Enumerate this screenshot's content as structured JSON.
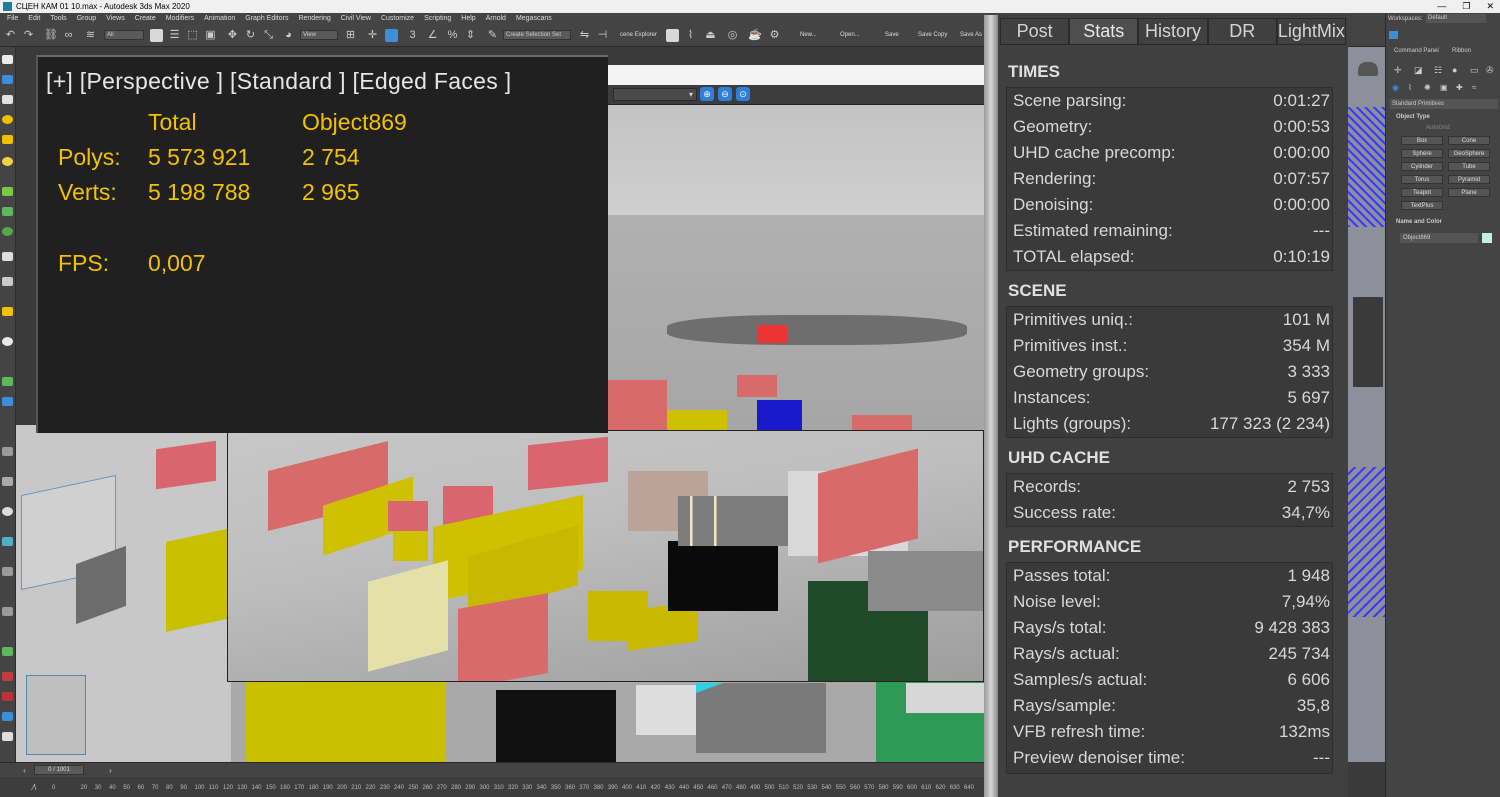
{
  "window": {
    "title": "СЦЕН КАМ 01 10.max - Autodesk 3ds Max 2020",
    "controls": [
      "—",
      "❐",
      "✕"
    ]
  },
  "menu": [
    "File",
    "Edit",
    "Tools",
    "Group",
    "Views",
    "Create",
    "Modifiers",
    "Animation",
    "Graph Editors",
    "Rendering",
    "Civil View",
    "Customize",
    "Scripting",
    "Help",
    "Arnold",
    "Megascans"
  ],
  "toolbar": {
    "filter_dd": "All",
    "view_dd": "View",
    "selection_set_dd": "Create Selection Set",
    "scene_explorer_label": "cene Explorer",
    "new_label": "New...",
    "open_label": "Open...",
    "save_label": "Save",
    "save_copy_label": "Save Copy",
    "save_as_label": "Save As"
  },
  "overlay": {
    "header": "[+] [Perspective ] [Standard ] [Edged Faces ]",
    "col_total": "Total",
    "col_object": "Object869",
    "polys_label": "Polys:",
    "polys_total": "5 573 921",
    "polys_object": "2 754",
    "verts_label": "Verts:",
    "verts_total": "5 198 788",
    "verts_object": "2 965",
    "fps_label": "FPS:",
    "fps_value": "0,007"
  },
  "vfb_panel": {
    "tabs": [
      "Post",
      "Stats",
      "History",
      "DR",
      "LightMix"
    ],
    "active_tab": "Stats",
    "sections": [
      {
        "title": "TIMES",
        "rows": [
          [
            "Scene parsing:",
            "0:01:27"
          ],
          [
            "Geometry:",
            "0:00:53"
          ],
          [
            "UHD cache precomp:",
            "0:00:00"
          ],
          [
            "Rendering:",
            "0:07:57"
          ],
          [
            "Denoising:",
            "0:00:00"
          ],
          [
            "Estimated remaining:",
            "---"
          ],
          [
            "TOTAL elapsed:",
            "0:10:19"
          ]
        ]
      },
      {
        "title": "SCENE",
        "rows": [
          [
            "Primitives uniq.:",
            "101 M"
          ],
          [
            "Primitives inst.:",
            "354 M"
          ],
          [
            "Geometry groups:",
            "3 333"
          ],
          [
            "Instances:",
            "5 697"
          ],
          [
            "Lights (groups):",
            "177 323 (2 234)"
          ]
        ]
      },
      {
        "title": "UHD CACHE",
        "rows": [
          [
            "Records:",
            "2 753"
          ],
          [
            "Success rate:",
            "34,7%"
          ]
        ]
      },
      {
        "title": "PERFORMANCE",
        "rows": [
          [
            "Passes total:",
            "1 948"
          ],
          [
            "Noise level:",
            "7,94%"
          ],
          [
            "Rays/s total:",
            "9 428 383"
          ],
          [
            "Rays/s actual:",
            "245 734"
          ],
          [
            "Samples/s actual:",
            "6 606"
          ],
          [
            "Rays/sample:",
            "35,8"
          ],
          [
            "VFB refresh time:",
            "132ms"
          ],
          [
            "Preview denoiser time:",
            "---"
          ]
        ]
      }
    ]
  },
  "command_panel": {
    "workspaces_label": "Workspaces:",
    "workspace_value": "Default",
    "tab_command": "Command Panel",
    "tab_ribbon": "Ribbon",
    "category_dd": "Standard Primitives",
    "object_type_title": "Object Type",
    "autogrid_label": "AutoGrid",
    "buttons": [
      "Box",
      "Cone",
      "Sphere",
      "GeoSphere",
      "Cylinder",
      "Tube",
      "Torus",
      "Pyramid",
      "Teapot",
      "Plane",
      "TextPlus"
    ],
    "name_color_title": "Name and Color",
    "object_name": "Object869"
  },
  "timeslider": {
    "frame_label": "0 / 1001",
    "ticks": [
      "0",
      "10",
      "20",
      "30",
      "40",
      "50",
      "60",
      "70",
      "80",
      "90",
      "100",
      "110",
      "120",
      "130",
      "140",
      "150",
      "160",
      "170",
      "180",
      "190",
      "200",
      "210",
      "220",
      "230",
      "240",
      "250",
      "260",
      "270",
      "280",
      "290",
      "300",
      "310",
      "320",
      "330",
      "340",
      "350",
      "360",
      "370",
      "380",
      "390",
      "400",
      "410",
      "420",
      "430",
      "440",
      "450",
      "460",
      "470",
      "480",
      "490",
      "500",
      "510",
      "520",
      "530",
      "540",
      "550",
      "560",
      "570",
      "580",
      "590",
      "600",
      "610",
      "620",
      "630",
      "640"
    ]
  },
  "colors": {
    "overlay_text": "#f2c200",
    "panel_bg": "#404040",
    "accent_blue": "#2f7fd9"
  }
}
